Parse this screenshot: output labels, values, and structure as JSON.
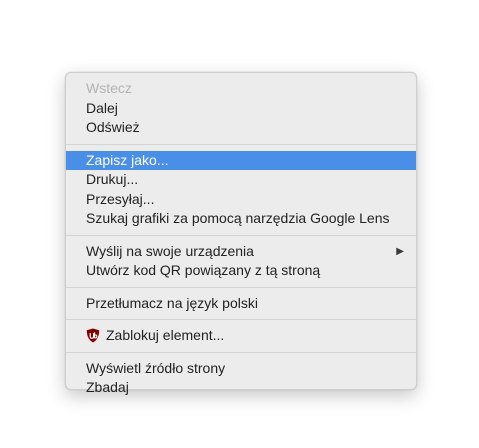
{
  "menu": {
    "items": [
      {
        "label": "Wstecz"
      },
      {
        "label": "Dalej"
      },
      {
        "label": "Odśwież"
      },
      {
        "label": "Zapisz jako..."
      },
      {
        "label": "Drukuj..."
      },
      {
        "label": "Przesyłaj..."
      },
      {
        "label": "Szukaj grafiki za pomocą narzędzia Google Lens"
      },
      {
        "label": "Wyślij na swoje urządzenia"
      },
      {
        "label": "Utwórz kod QR powiązany z tą stroną"
      },
      {
        "label": "Przetłumacz na język polski"
      },
      {
        "label": "Zablokuj element..."
      },
      {
        "label": "Wyświetl źródło strony"
      },
      {
        "label": "Zbadaj"
      }
    ],
    "submenu_arrow": "▶",
    "icons": {
      "extension_icon": "ublock-origin-shield-icon"
    },
    "colors": {
      "highlight": "#4a8fe7",
      "disabled_text": "#b3b3b3",
      "ublock_red": "#800000"
    }
  }
}
